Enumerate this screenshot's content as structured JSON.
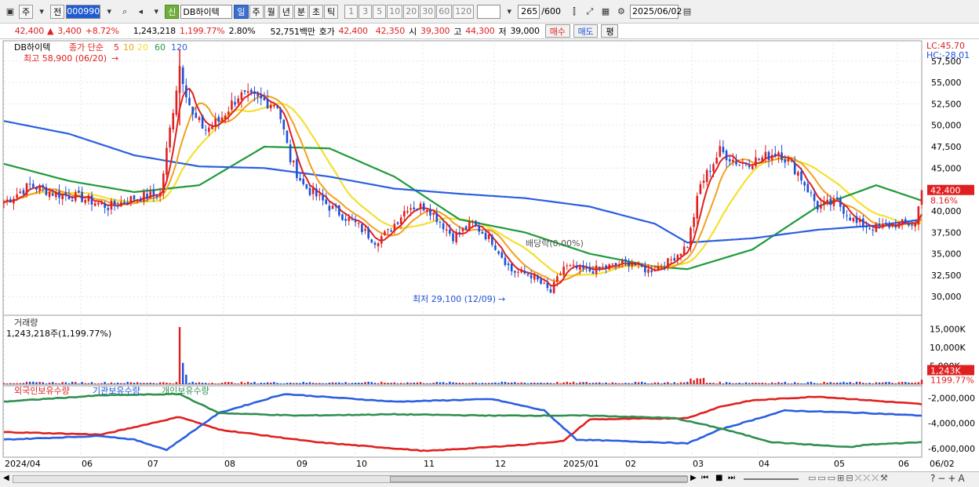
{
  "toolbar": {
    "market": "주",
    "prev": "전",
    "code": "000990",
    "stock_tag": "신",
    "stock_name": "DB하이텍",
    "periods": [
      "일",
      "주",
      "월",
      "년",
      "분",
      "초",
      "틱"
    ],
    "intervals": [
      "1",
      "3",
      "5",
      "10",
      "20",
      "30",
      "60",
      "120"
    ],
    "count": "265",
    "count_max": "/600",
    "date": "2025/06/02"
  },
  "quote": {
    "price": "42,400",
    "arrow": "▲",
    "change": "3,400",
    "change_pct": "+8.72%",
    "volume": "1,243,218",
    "volume_pct": "1,199.77%",
    "turnover": "2.80%",
    "amount": "52,751백만",
    "bid_ask_label": "호가",
    "ask": "42,400",
    "bid": "42,350",
    "open_label": "시",
    "open": "39,300",
    "high_label": "고",
    "high": "44,300",
    "low_label": "저",
    "low": "39,000",
    "buy": "매수",
    "sell": "매도",
    "eval": "평"
  },
  "legend": {
    "name": "DB하이텍",
    "price_type": "종가 단순",
    "ma": [
      "5",
      "10",
      "20",
      "60",
      "120"
    ]
  },
  "ann": {
    "high": "최고 58,900 (06/20)",
    "low": "최저 29,100 (12/09)",
    "dividend": "배당락(0.00%)",
    "lc": "LC:45.70",
    "hc": "HC:-28.01"
  },
  "price_ticks": [
    "57,500",
    "55,000",
    "52,500",
    "50,000",
    "47,500",
    "45,000",
    "42,500",
    "40,000",
    "37,500",
    "35,000",
    "32,500",
    "30,000"
  ],
  "last_price": "42,400",
  "last_pct": "8.16%",
  "volume_panel": {
    "title": "거래량",
    "info": "1,243,218주(1,199.77%)",
    "ticks": [
      "15,000K",
      "10,000K",
      "5,000K"
    ],
    "last": "1,243K",
    "last_pct": "1199.77%"
  },
  "holdings": {
    "legend": [
      "외국인보유수량",
      "기관보유수량",
      "개인보유수량"
    ],
    "ticks": [
      "-2,000,000",
      "-4,000,000",
      "-6,000,000"
    ]
  },
  "x_labels": [
    "2024/04",
    "06",
    "07",
    "08",
    "09",
    "10",
    "11",
    "12",
    "2025/01",
    "02",
    "03",
    "04",
    "05",
    "06",
    "06/02"
  ],
  "chart_data": [
    {
      "type": "candlestick",
      "series": [
        {
          "name": "5",
          "color": "#e02020"
        },
        {
          "name": "10",
          "color": "#f0a020"
        },
        {
          "name": "20",
          "color": "#f4e030"
        },
        {
          "name": "60",
          "color": "#1f9a3a"
        },
        {
          "name": "120",
          "color": "#2b5fe0"
        }
      ],
      "anchors": [
        [
          0,
          41000
        ],
        [
          8,
          43000
        ],
        [
          16,
          42000
        ],
        [
          24,
          41500
        ],
        [
          32,
          40500
        ],
        [
          40,
          41500
        ],
        [
          48,
          42000
        ],
        [
          54,
          57000
        ],
        [
          58,
          51000
        ],
        [
          62,
          49500
        ],
        [
          66,
          50500
        ],
        [
          72,
          53500
        ],
        [
          78,
          53000
        ],
        [
          84,
          52500
        ],
        [
          88,
          46000
        ],
        [
          92,
          43000
        ],
        [
          100,
          40500
        ],
        [
          108,
          38500
        ],
        [
          114,
          36500
        ],
        [
          118,
          37500
        ],
        [
          124,
          40500
        ],
        [
          130,
          40500
        ],
        [
          138,
          37000
        ],
        [
          144,
          38500
        ],
        [
          150,
          36500
        ],
        [
          156,
          33000
        ],
        [
          162,
          32500
        ],
        [
          168,
          30500
        ],
        [
          172,
          33500
        ],
        [
          180,
          33000
        ],
        [
          186,
          33500
        ],
        [
          192,
          34000
        ],
        [
          198,
          33000
        ],
        [
          204,
          34000
        ],
        [
          210,
          36000
        ],
        [
          214,
          43000
        ],
        [
          220,
          47000
        ],
        [
          226,
          45500
        ],
        [
          232,
          46000
        ],
        [
          238,
          47000
        ],
        [
          244,
          44500
        ],
        [
          250,
          40500
        ],
        [
          256,
          41000
        ],
        [
          262,
          38500
        ],
        [
          268,
          38000
        ],
        [
          274,
          38500
        ],
        [
          280,
          38500
        ],
        [
          282,
          42400
        ]
      ],
      "ma60": [
        [
          0,
          45500
        ],
        [
          20,
          43500
        ],
        [
          40,
          42200
        ],
        [
          60,
          43000
        ],
        [
          80,
          47500
        ],
        [
          100,
          47300
        ],
        [
          120,
          44000
        ],
        [
          140,
          39000
        ],
        [
          160,
          37500
        ],
        [
          180,
          35000
        ],
        [
          200,
          33500
        ],
        [
          210,
          33200
        ],
        [
          230,
          35500
        ],
        [
          250,
          40500
        ],
        [
          268,
          43000
        ],
        [
          282,
          41200
        ]
      ],
      "ma120": [
        [
          0,
          50500
        ],
        [
          20,
          49000
        ],
        [
          40,
          46500
        ],
        [
          60,
          45200
        ],
        [
          80,
          45000
        ],
        [
          100,
          44000
        ],
        [
          120,
          42600
        ],
        [
          140,
          42000
        ],
        [
          160,
          41500
        ],
        [
          180,
          40500
        ],
        [
          200,
          38500
        ],
        [
          210,
          36300
        ],
        [
          230,
          36800
        ],
        [
          250,
          37800
        ],
        [
          268,
          38300
        ],
        [
          282,
          39000
        ]
      ],
      "ylim": [
        28000,
        59500
      ]
    },
    {
      "type": "bar",
      "title": "거래량",
      "spike_index": 54,
      "spike_value": 15500,
      "last_index": 282,
      "last_value": 1243
    },
    {
      "type": "line",
      "series": [
        {
          "name": "외국인보유수량",
          "color": "#e02020",
          "points": [
            [
              0,
              -4700000
            ],
            [
              30,
              -4900000
            ],
            [
              54,
              -3500000
            ],
            [
              66,
              -4500000
            ],
            [
              96,
              -5500000
            ],
            [
              130,
              -6200000
            ],
            [
              160,
              -5700000
            ],
            [
              172,
              -5400000
            ],
            [
              180,
              -3700000
            ],
            [
              210,
              -3600000
            ],
            [
              220,
              -2700000
            ],
            [
              230,
              -2200000
            ],
            [
              250,
              -1900000
            ],
            [
              282,
              -2500000
            ]
          ]
        },
        {
          "name": "기관보유수량",
          "color": "#2b5fe0",
          "points": [
            [
              0,
              -5300000
            ],
            [
              30,
              -5000000
            ],
            [
              40,
              -5300000
            ],
            [
              50,
              -6100000
            ],
            [
              66,
              -3200000
            ],
            [
              86,
              -1700000
            ],
            [
              120,
              -2300000
            ],
            [
              150,
              -2100000
            ],
            [
              166,
              -3000000
            ],
            [
              176,
              -5300000
            ],
            [
              200,
              -5500000
            ],
            [
              210,
              -5600000
            ],
            [
              220,
              -4500000
            ],
            [
              240,
              -3000000
            ],
            [
              265,
              -3200000
            ],
            [
              282,
              -3400000
            ]
          ]
        },
        {
          "name": "개인보유수량",
          "color": "#2f8f4f",
          "points": [
            [
              0,
              -2300000
            ],
            [
              30,
              -1800000
            ],
            [
              54,
              -1700000
            ],
            [
              66,
              -3200000
            ],
            [
              90,
              -3400000
            ],
            [
              120,
              -3300000
            ],
            [
              150,
              -3400000
            ],
            [
              180,
              -3400000
            ],
            [
              206,
              -3600000
            ],
            [
              220,
              -4400000
            ],
            [
              236,
              -5500000
            ],
            [
              260,
              -5900000
            ],
            [
              265,
              -5700000
            ],
            [
              282,
              -5500000
            ]
          ]
        }
      ],
      "ylim": [
        -6500000,
        -1300000
      ]
    }
  ]
}
